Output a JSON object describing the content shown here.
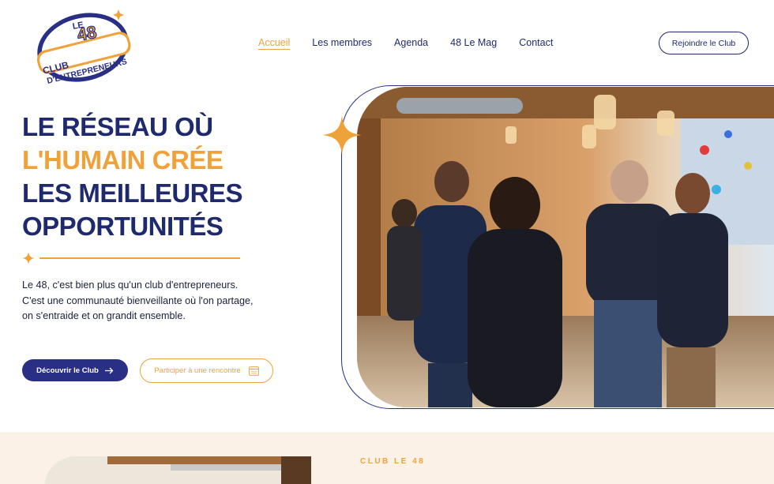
{
  "logo": {
    "text_top": "LE",
    "text_number": "48",
    "text_club": "CLUB",
    "text_sub": "D'ENTREPRENEURS"
  },
  "nav": {
    "items": [
      {
        "label": "Accueil",
        "active": true
      },
      {
        "label": "Les membres",
        "active": false
      },
      {
        "label": "Agenda",
        "active": false
      },
      {
        "label": "48 Le Mag",
        "active": false
      },
      {
        "label": "Contact",
        "active": false
      }
    ],
    "cta_label": "Rejoindre le Club"
  },
  "hero": {
    "headline": {
      "line1": "LE RÉSEAU OÙ",
      "line2": "L'HUMAIN CRÉE",
      "line3": "LES MEILLEURES",
      "line4": "OPPORTUNITÉS"
    },
    "intro_lines": [
      "Le 48, c'est bien plus qu'un club d'entrepreneurs.",
      "C'est une communauté bienveillante où l'on partage,",
      "on s'entraide et on grandit ensemble."
    ],
    "primary_button": "Découvrir le Club",
    "secondary_button": "Participer à une rencontre",
    "icons": {
      "primary": "arrow-right-icon",
      "secondary": "calendar-icon",
      "sparkle": "sparkle-icon"
    }
  },
  "section2": {
    "kicker": "CLUB LE 48"
  },
  "colors": {
    "navy": "#1f2a6e",
    "button_navy": "#2a2f86",
    "orange": "#f0a23a",
    "cream": "#fbf1e6"
  }
}
